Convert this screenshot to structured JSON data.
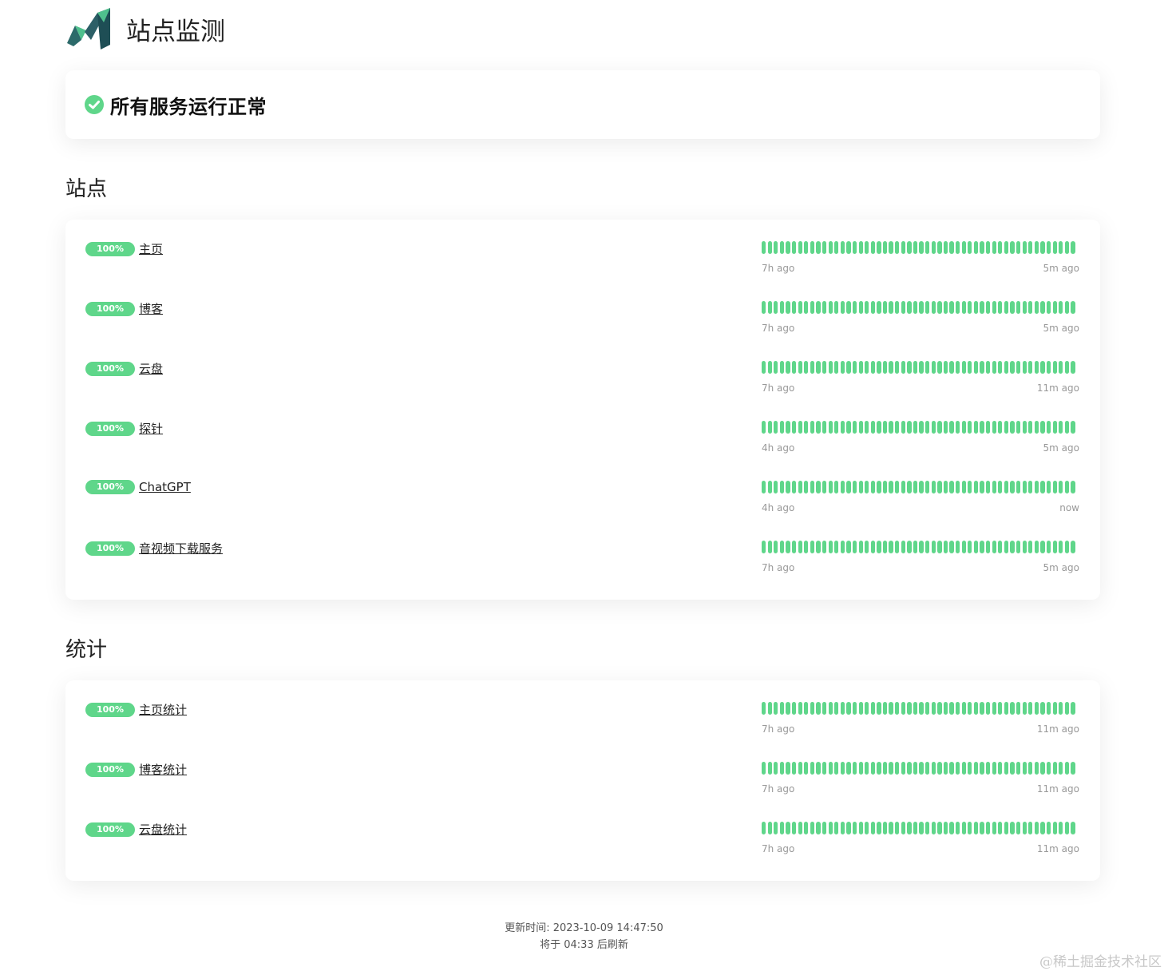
{
  "header": {
    "title": "站点监测",
    "logo_icon": "brand-logo-icon"
  },
  "overall_status": {
    "text": "所有服务运行正常",
    "icon": "check-circle-icon",
    "color": "#5fd68a"
  },
  "groups": [
    {
      "title": "站点",
      "monitors": [
        {
          "uptime": "100%",
          "name": "主页",
          "from": "7h ago",
          "to": "5m ago"
        },
        {
          "uptime": "100%",
          "name": "博客",
          "from": "7h ago",
          "to": "5m ago"
        },
        {
          "uptime": "100%",
          "name": "云盘",
          "from": "7h ago",
          "to": "11m ago"
        },
        {
          "uptime": "100%",
          "name": "探针",
          "from": "4h ago",
          "to": "5m ago"
        },
        {
          "uptime": "100%",
          "name": "ChatGPT",
          "from": "4h ago",
          "to": "now"
        },
        {
          "uptime": "100%",
          "name": "音视频下载服务",
          "from": "7h ago",
          "to": "5m ago"
        }
      ]
    },
    {
      "title": "统计",
      "monitors": [
        {
          "uptime": "100%",
          "name": "主页统计",
          "from": "7h ago",
          "to": "11m ago"
        },
        {
          "uptime": "100%",
          "name": "博客统计",
          "from": "7h ago",
          "to": "11m ago"
        },
        {
          "uptime": "100%",
          "name": "云盘统计",
          "from": "7h ago",
          "to": "11m ago"
        }
      ]
    }
  ],
  "heartbeat": {
    "beats_per_monitor": 52,
    "color": "#5fd68a"
  },
  "footer": {
    "updated": "更新时间: 2023-10-09 14:47:50",
    "refresh": "将于 04:33 后刷新"
  },
  "watermark": "@稀土掘金技术社区"
}
